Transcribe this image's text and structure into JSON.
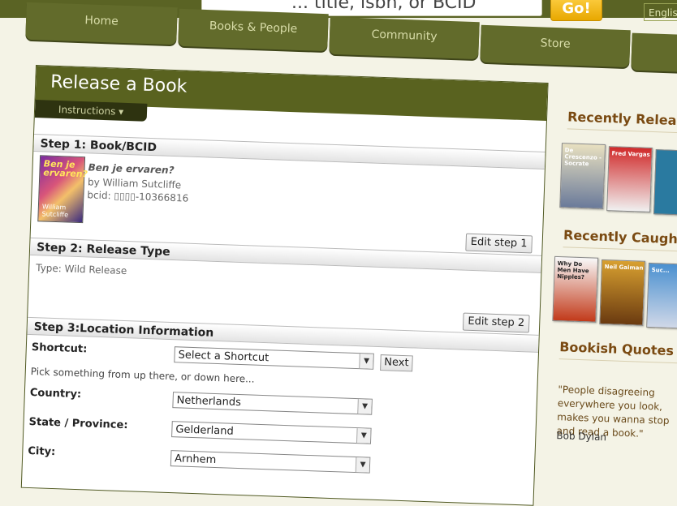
{
  "search": {
    "text": "... title, isbn, or BCID",
    "go_label": "Go!"
  },
  "language": {
    "label": "English"
  },
  "nav": {
    "tabs": [
      "Home",
      "Books & People",
      "Community",
      "Store"
    ]
  },
  "panel": {
    "title": "Release a Book",
    "instructions_label": "Instructions ▾",
    "step1": {
      "title": "Step 1: Book/BCID",
      "book_title": "Ben je ervaren?",
      "book_author": "by William Sutcliffe",
      "bcid": "bcid: ▯▯▯▯-10366816",
      "cover_title": "Ben je ervaren?",
      "cover_author": "William Sutcliffe"
    },
    "step2": {
      "title": "Step 2: Release Type",
      "edit_label": "Edit step 1",
      "release_type": "Type: Wild Release"
    },
    "step3": {
      "title": "Step 3:Location Information",
      "edit_label": "Edit step 2",
      "shortcut_label": "Shortcut:",
      "shortcut_value": "Select a Shortcut",
      "next_label": "Next",
      "hint": "Pick something from up there, or down here...",
      "country_label": "Country:",
      "country_value": "Netherlands",
      "state_label": "State / Province:",
      "state_value": "Gelderland",
      "city_label": "City:",
      "city_value": "Arnhem"
    }
  },
  "sidebar": {
    "recently_released": "Recently Released",
    "recently_caught": "Recently Caught",
    "bookish_quotes": "Bookish Quotes",
    "quote": "\"People disagreeing everywhere you look, makes you wanna stop and read a book.\"",
    "quote_author": "Bob Dylan",
    "released_books": [
      "De Crescenzo - Socrate",
      "Fred Vargas"
    ],
    "caught_books": [
      "Why Do Men Have Nipples?",
      "Neil Gaiman",
      "Suc..."
    ]
  },
  "colors": {
    "nav_bg": "#5a6324",
    "accent": "#7a4a12",
    "go": "#e8a800"
  }
}
